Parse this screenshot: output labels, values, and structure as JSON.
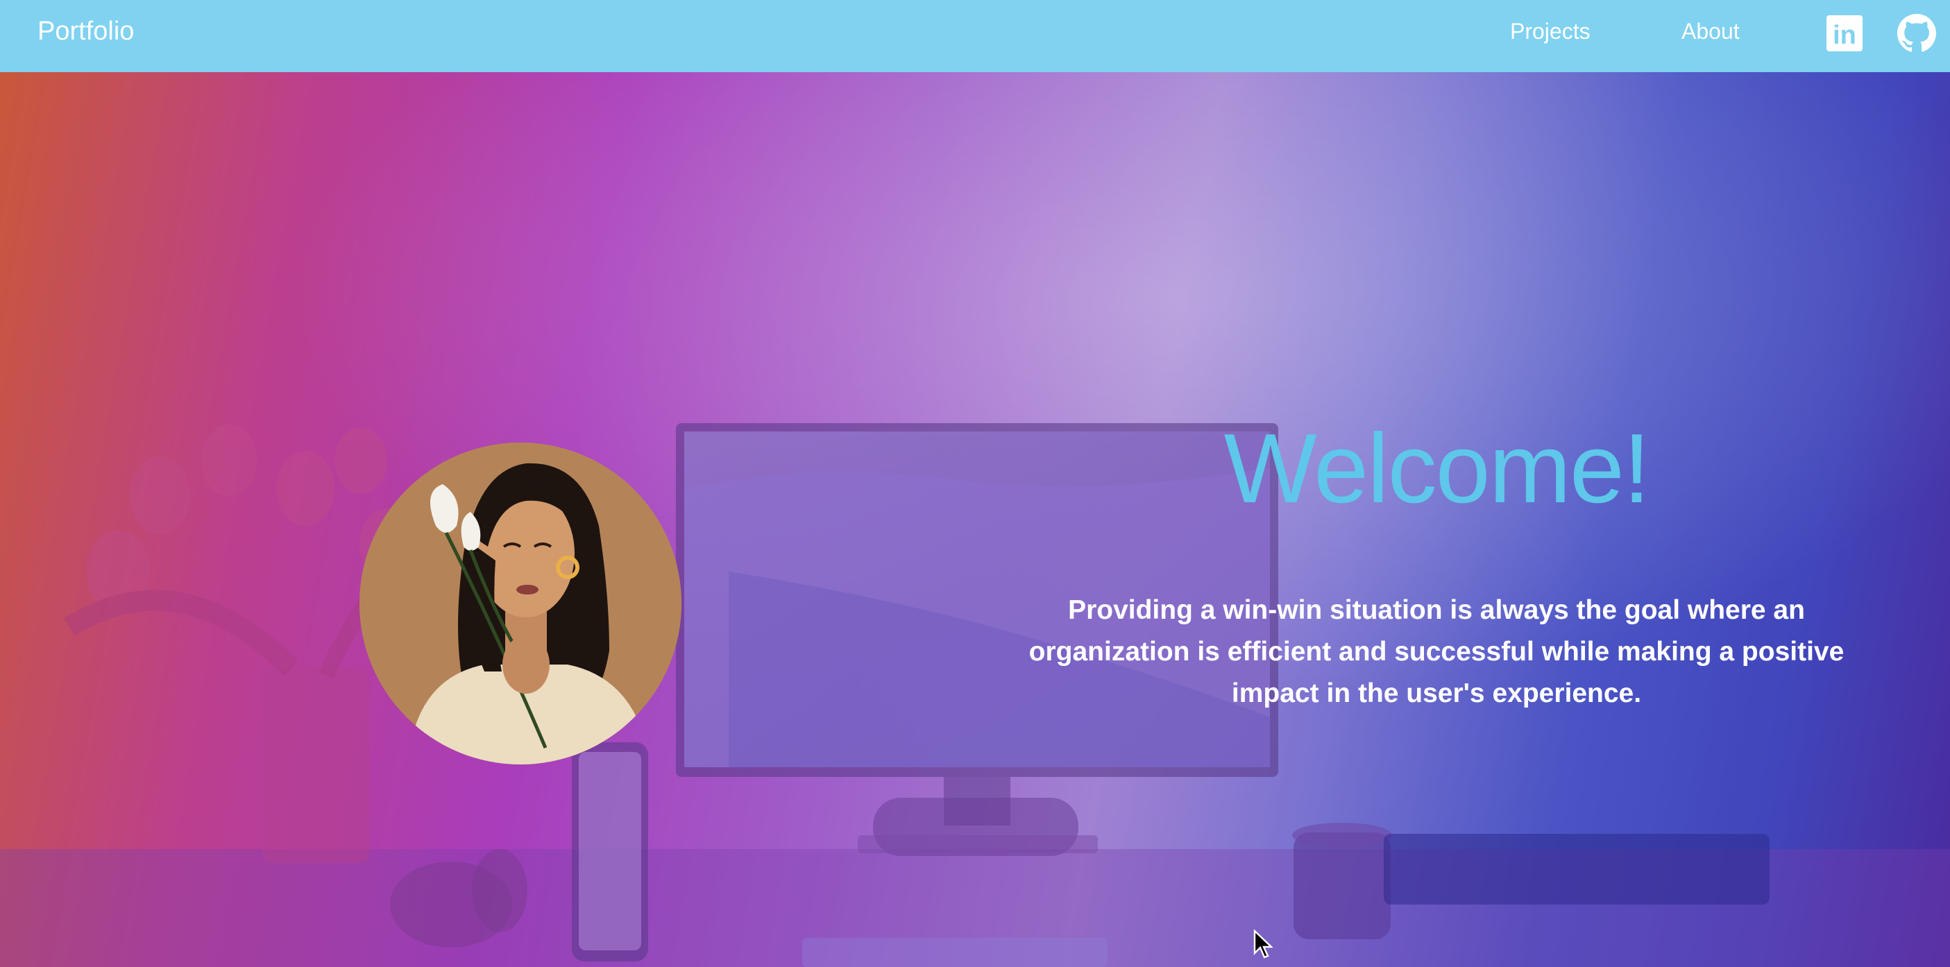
{
  "navbar": {
    "brand": "Portfolio",
    "links": [
      {
        "label": "Projects"
      },
      {
        "label": "About"
      }
    ],
    "social": [
      {
        "icon": "linkedin-icon",
        "text": "in"
      },
      {
        "icon": "github-icon"
      }
    ],
    "background_color": "#80d2f0"
  },
  "hero": {
    "title": "Welcome!",
    "tagline": "Providing a win-win situation is always the goal where an organization is efficient and successful while making a positive impact in the user's experience.",
    "title_color": "#5ec7ea"
  }
}
